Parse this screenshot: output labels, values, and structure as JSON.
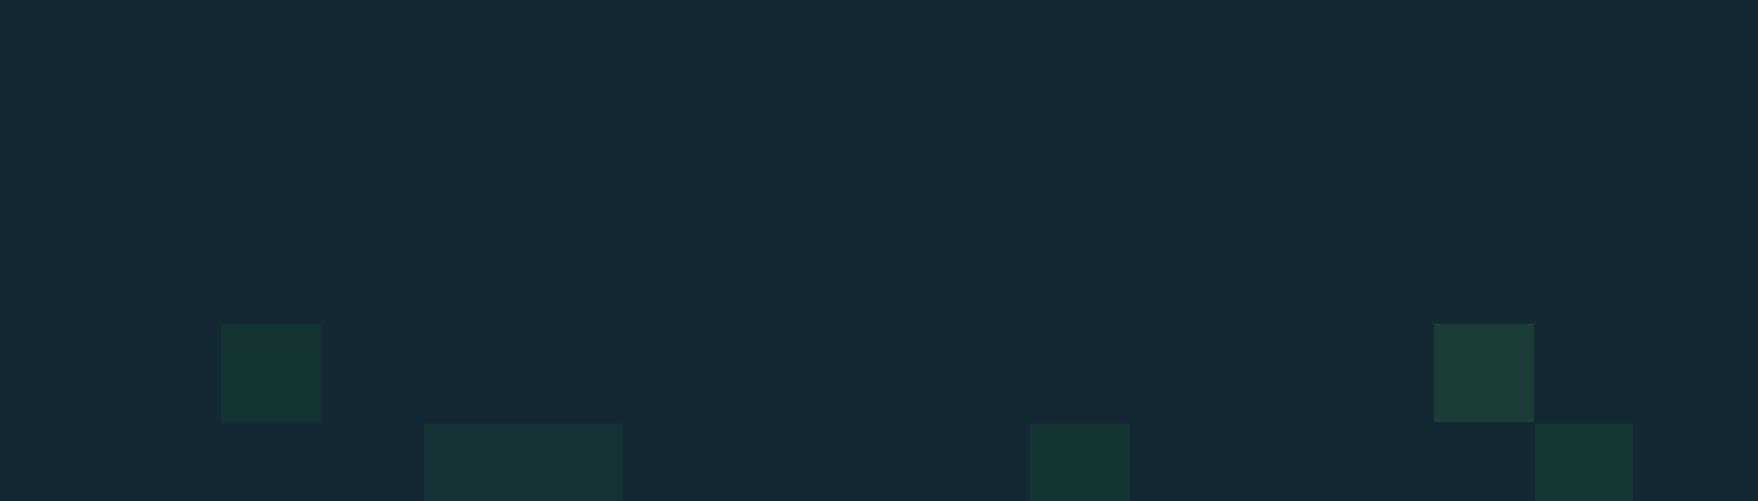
{
  "background": {
    "base_color": "#132833",
    "grid_line_color": "#2b4653",
    "highlight_colors": [
      "#173a36",
      "#1a3f38",
      "#163934"
    ]
  }
}
